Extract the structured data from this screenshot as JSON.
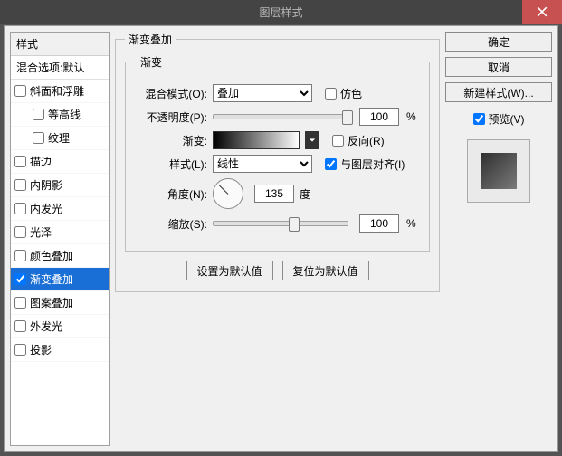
{
  "title": "图层样式",
  "sidebar": {
    "header": "样式",
    "blend_defaults": "混合选项:默认",
    "items": [
      {
        "label": "斜面和浮雕",
        "checked": false,
        "indent": false,
        "selected": false
      },
      {
        "label": "等高线",
        "checked": false,
        "indent": true,
        "selected": false
      },
      {
        "label": "纹理",
        "checked": false,
        "indent": true,
        "selected": false
      },
      {
        "label": "描边",
        "checked": false,
        "indent": false,
        "selected": false
      },
      {
        "label": "内阴影",
        "checked": false,
        "indent": false,
        "selected": false
      },
      {
        "label": "内发光",
        "checked": false,
        "indent": false,
        "selected": false
      },
      {
        "label": "光泽",
        "checked": false,
        "indent": false,
        "selected": false
      },
      {
        "label": "颜色叠加",
        "checked": false,
        "indent": false,
        "selected": false
      },
      {
        "label": "渐变叠加",
        "checked": true,
        "indent": false,
        "selected": true
      },
      {
        "label": "图案叠加",
        "checked": false,
        "indent": false,
        "selected": false
      },
      {
        "label": "外发光",
        "checked": false,
        "indent": false,
        "selected": false
      },
      {
        "label": "投影",
        "checked": false,
        "indent": false,
        "selected": false
      }
    ]
  },
  "center": {
    "legend": "渐变叠加",
    "group_legend": "渐变",
    "blend_mode_label": "混合模式(O):",
    "blend_mode_value": "叠加",
    "dither_label": "仿色",
    "opacity_label": "不透明度(P):",
    "opacity_value": "100",
    "opacity_pct": "%",
    "gradient_label": "渐变:",
    "reverse_label": "反向(R)",
    "style_label": "样式(L):",
    "style_value": "线性",
    "align_label": "与图层对齐(I)",
    "angle_label": "角度(N):",
    "angle_value": "135",
    "angle_unit": "度",
    "scale_label": "缩放(S):",
    "scale_value": "100",
    "scale_pct": "%",
    "set_default_btn": "设置为默认值",
    "reset_default_btn": "复位为默认值"
  },
  "right": {
    "ok": "确定",
    "cancel": "取消",
    "new_style": "新建样式(W)...",
    "preview_label": "预览(V)"
  }
}
